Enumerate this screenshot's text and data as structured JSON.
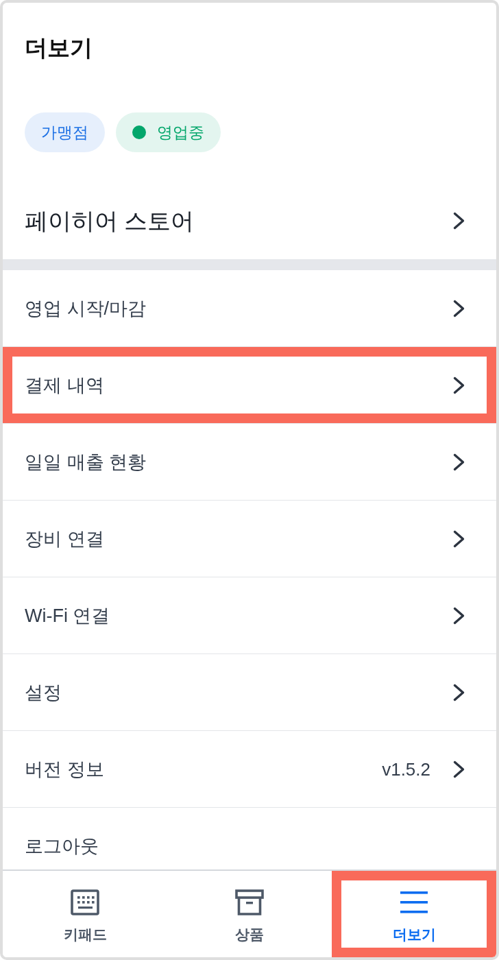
{
  "header": {
    "title": "더보기"
  },
  "badges": [
    {
      "label": "가맹점",
      "color": "#1b6fe4",
      "dot": false
    },
    {
      "label": "영업중",
      "color": "#03a66b",
      "dot": true
    }
  ],
  "store": {
    "name": "페이히어 스토어"
  },
  "menu": [
    {
      "label": "영업 시작/마감",
      "arrow": true,
      "highlighted": false
    },
    {
      "label": "결제 내역",
      "arrow": true,
      "highlighted": true
    },
    {
      "label": "일일 매출 현황",
      "arrow": true,
      "highlighted": false
    },
    {
      "label": "장비 연결",
      "arrow": true,
      "highlighted": false
    },
    {
      "label": "Wi-Fi 연결",
      "arrow": true,
      "highlighted": false
    },
    {
      "label": "설정",
      "arrow": true,
      "highlighted": false
    },
    {
      "label": "버전 정보",
      "value": "v1.5.2",
      "arrow": true,
      "highlighted": false
    },
    {
      "label": "로그아웃",
      "arrow": false,
      "highlighted": false
    }
  ],
  "tabs": [
    {
      "label": "키패드",
      "selected": false,
      "highlighted": false
    },
    {
      "label": "상품",
      "selected": false,
      "highlighted": false
    },
    {
      "label": "더보기",
      "selected": true,
      "highlighted": true
    }
  ]
}
